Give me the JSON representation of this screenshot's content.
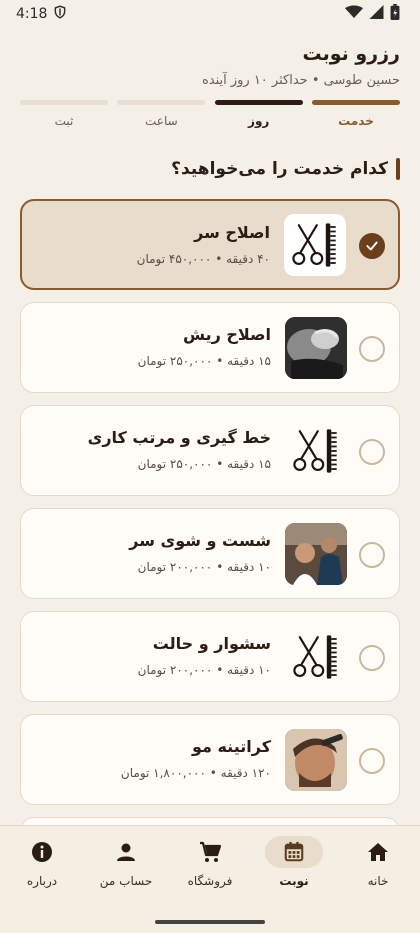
{
  "status_bar": {
    "time": "4:18"
  },
  "header": {
    "title": "رزرو نوبت",
    "subtitle": "حسین طوسی • حداکثر ۱۰ روز آینده"
  },
  "stepper": [
    {
      "label": "خدمت",
      "state": "done"
    },
    {
      "label": "روز",
      "state": "current"
    },
    {
      "label": "ساعت",
      "state": "pending"
    },
    {
      "label": "ثبت",
      "state": "pending"
    }
  ],
  "section_title": "کدام خدمت را می‌خواهید؟",
  "services": [
    {
      "name": "اصلاح سر",
      "meta": "۴۰ دقیقه • ۴۵۰,۰۰۰ تومان",
      "icon": "scissors-comb-icon",
      "selected": true
    },
    {
      "name": "اصلاح ریش",
      "meta": "۱۵ دقیقه • ۲۵۰,۰۰۰ تومان",
      "icon": "beard-shave-photo",
      "selected": false
    },
    {
      "name": "خط گیری و مرتب کاری",
      "meta": "۱۵ دقیقه • ۲۵۰,۰۰۰ تومان",
      "icon": "scissors-comb-icon",
      "selected": false
    },
    {
      "name": "شست و شوی سر",
      "meta": "۱۰ دقیقه • ۲۰۰,۰۰۰ تومان",
      "icon": "hair-wash-photo",
      "selected": false
    },
    {
      "name": "سشوار و حالت",
      "meta": "۱۰ دقیقه • ۲۰۰,۰۰۰ تومان",
      "icon": "scissors-comb-icon",
      "selected": false
    },
    {
      "name": "کراتینه مو",
      "meta": "۱۲۰ دقیقه • ۱,۸۰۰,۰۰۰ تومان",
      "icon": "keratin-photo",
      "selected": false
    }
  ],
  "bottom_nav": [
    {
      "label": "خانه",
      "icon": "home-icon",
      "active": false
    },
    {
      "label": "نوبت",
      "icon": "calendar-icon",
      "active": true
    },
    {
      "label": "فروشگاه",
      "icon": "cart-icon",
      "active": false
    },
    {
      "label": "حساب من",
      "icon": "person-icon",
      "active": false
    },
    {
      "label": "درباره",
      "icon": "info-icon",
      "active": false
    }
  ],
  "colors": {
    "accent": "#8b5a2b",
    "dark": "#2b1d14",
    "background": "#f5f0e7",
    "selected_card": "#e8dccc"
  }
}
